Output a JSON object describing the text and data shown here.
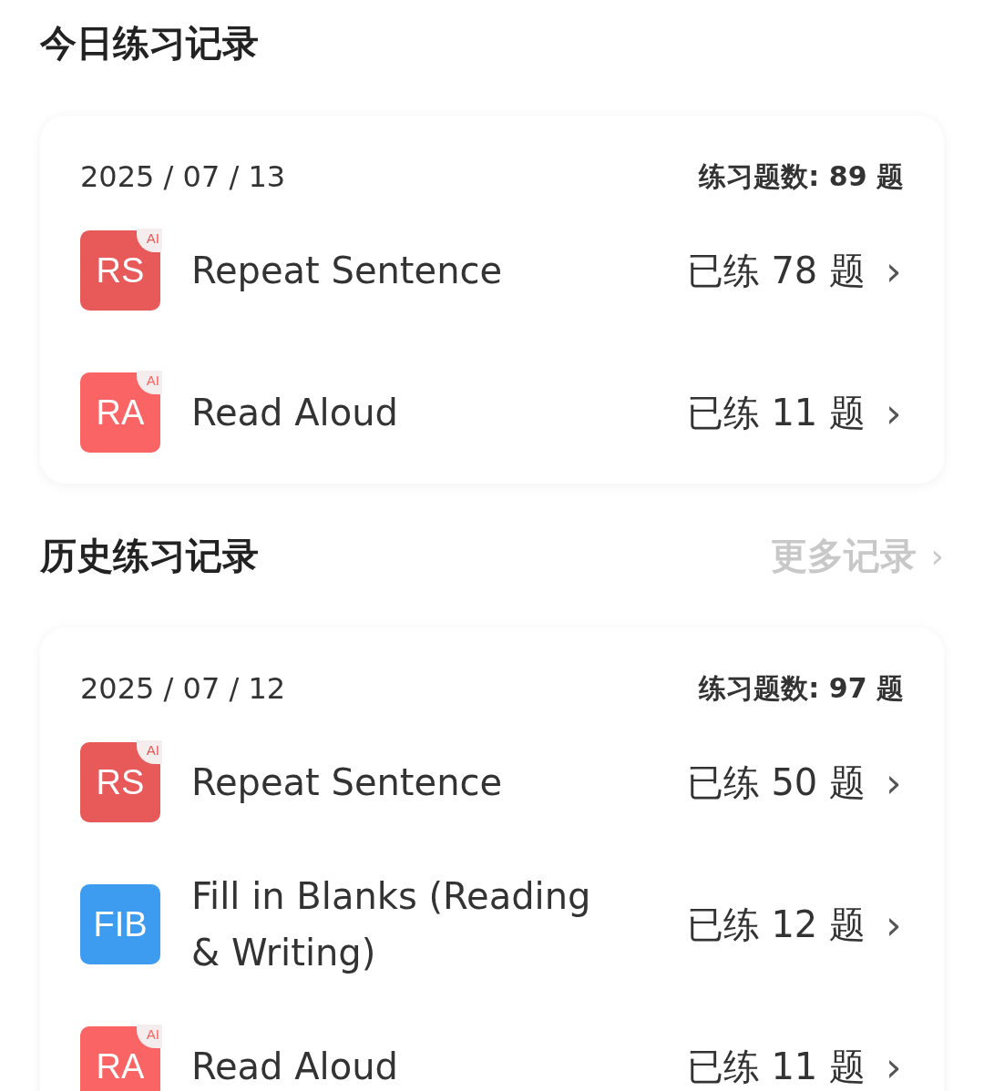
{
  "today": {
    "title": "今日练习记录",
    "card": {
      "date": "2025 / 07 / 13",
      "total": "练习题数: 89 题",
      "items": [
        {
          "code": "RS",
          "tag": "AI",
          "color": "#e85a5a",
          "name": "Repeat Sentence",
          "count": "已练 78 题",
          "chevron": "›"
        },
        {
          "code": "RA",
          "tag": "AI",
          "color": "#fb6464",
          "name": "Read Aloud",
          "count": "已练 11 题",
          "chevron": "›"
        }
      ]
    }
  },
  "history": {
    "title": "历史练习记录",
    "more": "更多记录",
    "more_chevron": "›",
    "card": {
      "date": "2025 / 07 / 12",
      "total": "练习题数: 97 题",
      "items": [
        {
          "code": "RS",
          "tag": "AI",
          "color": "#e85a5a",
          "name": "Repeat Sentence",
          "count": "已练 50 题",
          "chevron": "›"
        },
        {
          "code": "FIB",
          "color": "#3d9bf0",
          "name": "Fill in Blanks (Reading & Writing)",
          "count": "已练 12 题",
          "chevron": "›"
        },
        {
          "code": "RA",
          "tag": "AI",
          "color": "#fb6464",
          "name": "Read Aloud",
          "count": "已练 11 题",
          "chevron": "›"
        }
      ]
    }
  }
}
